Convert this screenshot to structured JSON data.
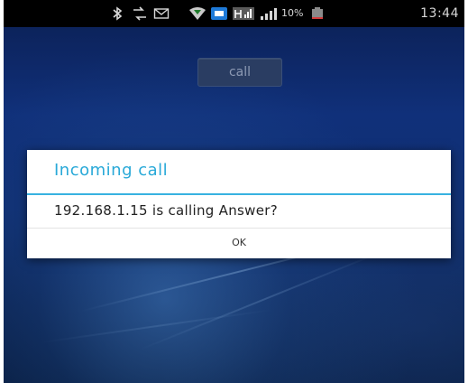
{
  "status_bar": {
    "icons": [
      "bluetooth-icon",
      "data-transfer-icon",
      "email-icon",
      "wifi-icon",
      "app-notification-icon",
      "signal-h-icon",
      "signal-strength-icon",
      "battery-icon"
    ],
    "battery_percent": "10%",
    "clock": "13:44"
  },
  "app": {
    "call_button_label": "call"
  },
  "dialog": {
    "title": "Incoming call",
    "message": "192.168.1.15 is calling Answer?",
    "ok_label": "OK"
  },
  "colors": {
    "dialog_title": "#29a9d8",
    "dialog_divider": "#38b2e0",
    "background_top": "#0b1f52",
    "background_bottom": "#071a3c"
  }
}
